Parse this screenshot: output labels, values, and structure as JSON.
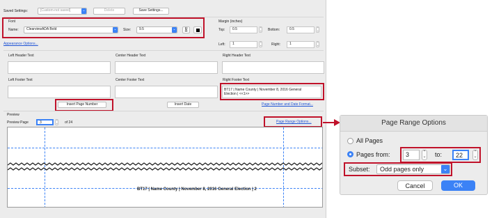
{
  "saved_settings": {
    "label": "Saved Settings:",
    "value": "[Custom-not saved]",
    "delete_label": "Delete",
    "save_label": "Save Settings..."
  },
  "font": {
    "section_label": "Font",
    "name_label": "Name:",
    "name_value": "ClearviewADA Bold",
    "size_label": "Size:",
    "size_value": "9.5",
    "underline_glyph": "U",
    "color_swatch": "#000000"
  },
  "margin": {
    "section_label": "Margin (inches)",
    "top_label": "Top:",
    "top_value": "0.5",
    "bottom_label": "Bottom:",
    "bottom_value": "0.5",
    "left_label": "Left:",
    "left_value": "1",
    "right_label": "Right:",
    "right_value": "1"
  },
  "appearance_link": "Appearance Options...",
  "headers": {
    "left": "Left Header Text",
    "center": "Center Header Text",
    "right": "Right Header Text"
  },
  "footers": {
    "left": "Left Footer Text",
    "center": "Center Footer Text",
    "right": "Right Footer Text",
    "right_value_line1": "BT17 | Name County | November 8, 2016 General",
    "right_value_line2": "Election | <<1>>"
  },
  "buttons": {
    "insert_page_number": "Insert Page Number",
    "insert_date": "Insert Date"
  },
  "page_number_date_link": "Page Number and Date Format...",
  "preview": {
    "section_label": "Preview",
    "page_label": "Preview Page",
    "page_value": "3",
    "of_label": "of 24",
    "range_link": "Page Range Options...",
    "footer_text": "BT17 | Name County | November 8, 2016 General Election | 2"
  },
  "dialog": {
    "title": "Page Range Options",
    "all_pages_label": "All Pages",
    "pages_from_label": "Pages from:",
    "from_value": "3",
    "to_label": "to:",
    "to_value": "22",
    "subset_label": "Subset:",
    "subset_value": "Odd pages only",
    "cancel_label": "Cancel",
    "ok_label": "OK"
  },
  "colors": {
    "highlight": "#c0122a",
    "accent": "#3b82f6",
    "link": "#1f54d6"
  }
}
